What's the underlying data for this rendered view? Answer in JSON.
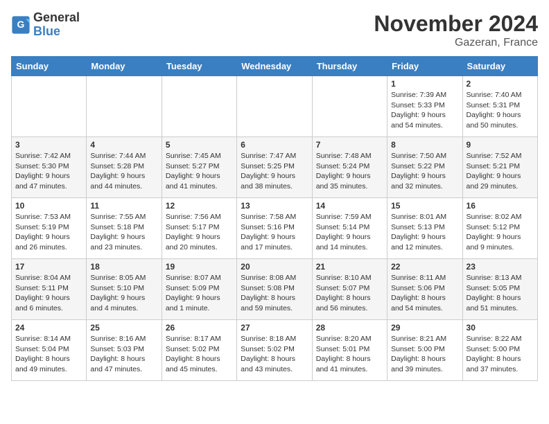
{
  "header": {
    "logo_general": "General",
    "logo_blue": "Blue",
    "month_title": "November 2024",
    "location": "Gazeran, France"
  },
  "columns": [
    "Sunday",
    "Monday",
    "Tuesday",
    "Wednesday",
    "Thursday",
    "Friday",
    "Saturday"
  ],
  "weeks": [
    [
      {
        "num": "",
        "info": ""
      },
      {
        "num": "",
        "info": ""
      },
      {
        "num": "",
        "info": ""
      },
      {
        "num": "",
        "info": ""
      },
      {
        "num": "",
        "info": ""
      },
      {
        "num": "1",
        "info": "Sunrise: 7:39 AM\nSunset: 5:33 PM\nDaylight: 9 hours\nand 54 minutes."
      },
      {
        "num": "2",
        "info": "Sunrise: 7:40 AM\nSunset: 5:31 PM\nDaylight: 9 hours\nand 50 minutes."
      }
    ],
    [
      {
        "num": "3",
        "info": "Sunrise: 7:42 AM\nSunset: 5:30 PM\nDaylight: 9 hours\nand 47 minutes."
      },
      {
        "num": "4",
        "info": "Sunrise: 7:44 AM\nSunset: 5:28 PM\nDaylight: 9 hours\nand 44 minutes."
      },
      {
        "num": "5",
        "info": "Sunrise: 7:45 AM\nSunset: 5:27 PM\nDaylight: 9 hours\nand 41 minutes."
      },
      {
        "num": "6",
        "info": "Sunrise: 7:47 AM\nSunset: 5:25 PM\nDaylight: 9 hours\nand 38 minutes."
      },
      {
        "num": "7",
        "info": "Sunrise: 7:48 AM\nSunset: 5:24 PM\nDaylight: 9 hours\nand 35 minutes."
      },
      {
        "num": "8",
        "info": "Sunrise: 7:50 AM\nSunset: 5:22 PM\nDaylight: 9 hours\nand 32 minutes."
      },
      {
        "num": "9",
        "info": "Sunrise: 7:52 AM\nSunset: 5:21 PM\nDaylight: 9 hours\nand 29 minutes."
      }
    ],
    [
      {
        "num": "10",
        "info": "Sunrise: 7:53 AM\nSunset: 5:19 PM\nDaylight: 9 hours\nand 26 minutes."
      },
      {
        "num": "11",
        "info": "Sunrise: 7:55 AM\nSunset: 5:18 PM\nDaylight: 9 hours\nand 23 minutes."
      },
      {
        "num": "12",
        "info": "Sunrise: 7:56 AM\nSunset: 5:17 PM\nDaylight: 9 hours\nand 20 minutes."
      },
      {
        "num": "13",
        "info": "Sunrise: 7:58 AM\nSunset: 5:16 PM\nDaylight: 9 hours\nand 17 minutes."
      },
      {
        "num": "14",
        "info": "Sunrise: 7:59 AM\nSunset: 5:14 PM\nDaylight: 9 hours\nand 14 minutes."
      },
      {
        "num": "15",
        "info": "Sunrise: 8:01 AM\nSunset: 5:13 PM\nDaylight: 9 hours\nand 12 minutes."
      },
      {
        "num": "16",
        "info": "Sunrise: 8:02 AM\nSunset: 5:12 PM\nDaylight: 9 hours\nand 9 minutes."
      }
    ],
    [
      {
        "num": "17",
        "info": "Sunrise: 8:04 AM\nSunset: 5:11 PM\nDaylight: 9 hours\nand 6 minutes."
      },
      {
        "num": "18",
        "info": "Sunrise: 8:05 AM\nSunset: 5:10 PM\nDaylight: 9 hours\nand 4 minutes."
      },
      {
        "num": "19",
        "info": "Sunrise: 8:07 AM\nSunset: 5:09 PM\nDaylight: 9 hours\nand 1 minute."
      },
      {
        "num": "20",
        "info": "Sunrise: 8:08 AM\nSunset: 5:08 PM\nDaylight: 8 hours\nand 59 minutes."
      },
      {
        "num": "21",
        "info": "Sunrise: 8:10 AM\nSunset: 5:07 PM\nDaylight: 8 hours\nand 56 minutes."
      },
      {
        "num": "22",
        "info": "Sunrise: 8:11 AM\nSunset: 5:06 PM\nDaylight: 8 hours\nand 54 minutes."
      },
      {
        "num": "23",
        "info": "Sunrise: 8:13 AM\nSunset: 5:05 PM\nDaylight: 8 hours\nand 51 minutes."
      }
    ],
    [
      {
        "num": "24",
        "info": "Sunrise: 8:14 AM\nSunset: 5:04 PM\nDaylight: 8 hours\nand 49 minutes."
      },
      {
        "num": "25",
        "info": "Sunrise: 8:16 AM\nSunset: 5:03 PM\nDaylight: 8 hours\nand 47 minutes."
      },
      {
        "num": "26",
        "info": "Sunrise: 8:17 AM\nSunset: 5:02 PM\nDaylight: 8 hours\nand 45 minutes."
      },
      {
        "num": "27",
        "info": "Sunrise: 8:18 AM\nSunset: 5:02 PM\nDaylight: 8 hours\nand 43 minutes."
      },
      {
        "num": "28",
        "info": "Sunrise: 8:20 AM\nSunset: 5:01 PM\nDaylight: 8 hours\nand 41 minutes."
      },
      {
        "num": "29",
        "info": "Sunrise: 8:21 AM\nSunset: 5:00 PM\nDaylight: 8 hours\nand 39 minutes."
      },
      {
        "num": "30",
        "info": "Sunrise: 8:22 AM\nSunset: 5:00 PM\nDaylight: 8 hours\nand 37 minutes."
      }
    ]
  ]
}
